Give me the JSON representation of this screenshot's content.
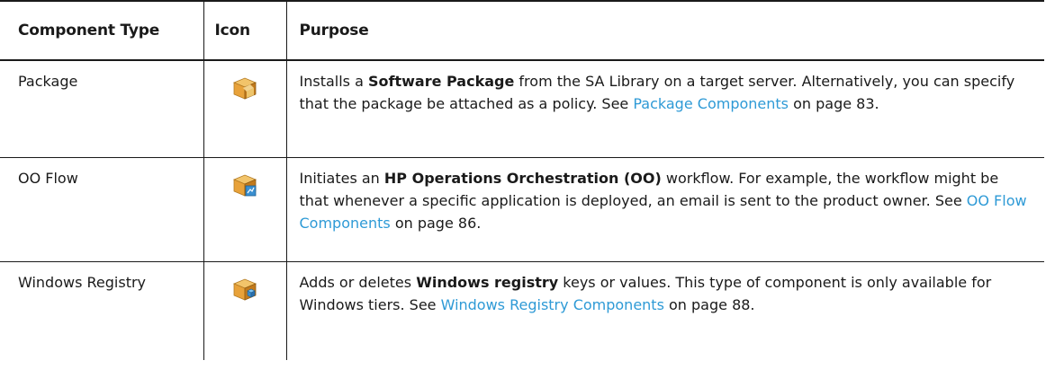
{
  "table": {
    "headers": {
      "type": "Component Type",
      "icon": "Icon",
      "purpose": "Purpose"
    },
    "rows": [
      {
        "type": "Package",
        "icon": "package-box-icon",
        "purpose": {
          "pre": "Installs a ",
          "bold": "Software Package",
          "mid": " from the SA Library on a target server. Alternatively, you can specify that the package be attached as a policy. See ",
          "link": "Package Components",
          "post": " on page 83."
        }
      },
      {
        "type": "OO Flow",
        "icon": "oo-flow-box-icon",
        "purpose": {
          "pre": "Initiates an ",
          "bold": "HP Operations Orchestration (OO)",
          "mid": " workflow. For example, the workflow might be that whenever a specific application is deployed, an email is sent to the product owner. See ",
          "link": "OO Flow Components",
          "post": " on page 86."
        }
      },
      {
        "type": "Windows Registry",
        "icon": "windows-registry-box-icon",
        "purpose": {
          "pre": "Adds or deletes ",
          "bold": "Windows registry",
          "mid": " keys or values. This type of component is only available for Windows tiers. See ",
          "link": "Windows Registry Components",
          "post": " on page 88."
        }
      }
    ]
  },
  "colors": {
    "link": "#2e9ad6",
    "box_orange": "#e8a23a",
    "box_top": "#f2c46a",
    "box_side": "#c27a1c",
    "cube_blue": "#3a8fd0"
  }
}
